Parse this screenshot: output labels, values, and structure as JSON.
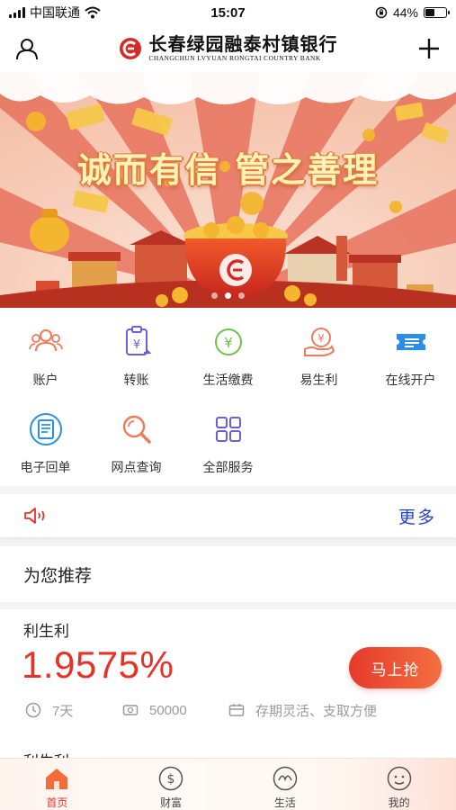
{
  "status_bar": {
    "carrier": "中国联通",
    "time": "15:07",
    "battery": "44%",
    "battery_level": 0.44
  },
  "header": {
    "bank_name_cn": "长春绿园融泰村镇银行",
    "bank_name_en": "CHANGCHUN LVYUAN RONGTAI COUNTRY BANK",
    "left_icon": "user-icon",
    "right_icon": "plus-icon"
  },
  "banner": {
    "slogan": "诚而有信 管之善理",
    "dots": 3,
    "active_dot": 0
  },
  "services": [
    {
      "label": "账户",
      "icon": "account-icon",
      "color": "#f07a5a"
    },
    {
      "label": "转账",
      "icon": "transfer-icon",
      "color": "#6b5fd6"
    },
    {
      "label": "生活缴费",
      "icon": "life-payment-icon",
      "color": "#6cc24a"
    },
    {
      "label": "易生利",
      "icon": "profit-icon",
      "color": "#f07a5a"
    },
    {
      "label": "在线开户",
      "icon": "online-account-icon",
      "color": "#2a8ee8"
    },
    {
      "label": "电子回单",
      "icon": "e-receipt-icon",
      "color": "#2a8ee8"
    },
    {
      "label": "网点查询",
      "icon": "branch-search-icon",
      "color": "#f07a5a"
    },
    {
      "label": "全部服务",
      "icon": "all-services-icon",
      "color": "#6b5fd6"
    }
  ],
  "notice": {
    "icon": "speaker-icon",
    "more_label": "更多"
  },
  "recommend": {
    "title": "为您推荐"
  },
  "product": {
    "name": "利生利",
    "rate": "1.9575%",
    "button_label": "马上抢",
    "term": "7天",
    "min_amount": "50000",
    "feature": "存期灵活、支取方便",
    "next_name": "利生利"
  },
  "tabbar": [
    {
      "label": "首页",
      "icon": "home-icon",
      "active": true
    },
    {
      "label": "财富",
      "icon": "wealth-icon",
      "active": false
    },
    {
      "label": "生活",
      "icon": "life-icon",
      "active": false
    },
    {
      "label": "我的",
      "icon": "mine-icon",
      "active": false
    }
  ],
  "colors": {
    "accent_red": "#e5332a",
    "link_blue": "#2440c8",
    "muted_gray": "#9a9a9a"
  }
}
